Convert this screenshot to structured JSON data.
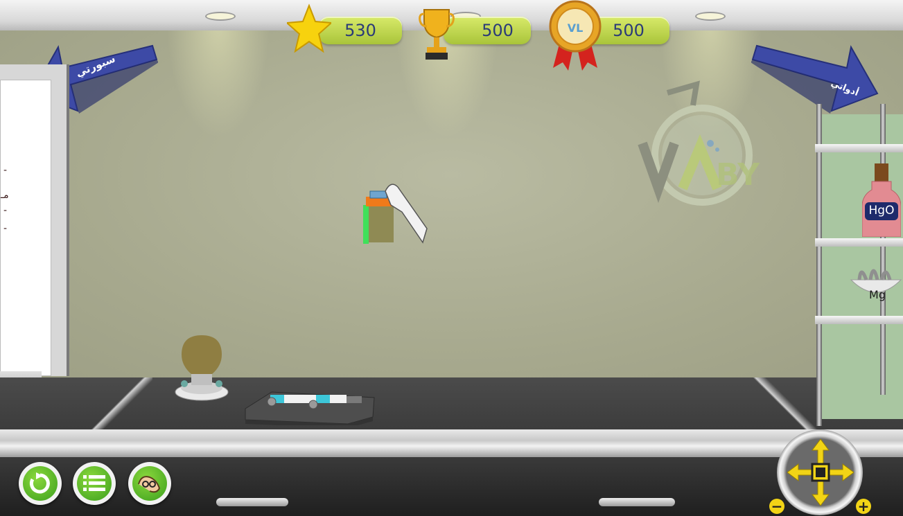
{
  "hud": {
    "stars": "530",
    "trophies": "500",
    "medals": "500"
  },
  "navigation": {
    "left_arrow_label": "سبورتي",
    "right_arrow_label": "أدواتي"
  },
  "shelf": {
    "bottle_label": "HgO",
    "dish_label": "Mg"
  },
  "board": {
    "fragments": [
      "-",
      "مـ",
      "-",
      "-"
    ]
  },
  "icons": {
    "star": "star-icon",
    "trophy": "trophy-icon",
    "medal": "medal-icon",
    "restart": "restart-icon",
    "list": "list-icon",
    "audio": "audio-icon",
    "zoom_out": "minus-icon",
    "zoom_in": "plus-icon"
  },
  "colors": {
    "hud_pill": "#b9d24a",
    "hud_text": "#2b3b78",
    "arrow": "#3a4aa8",
    "button_green": "#4cae25",
    "dpad_yellow": "#f2d416"
  }
}
